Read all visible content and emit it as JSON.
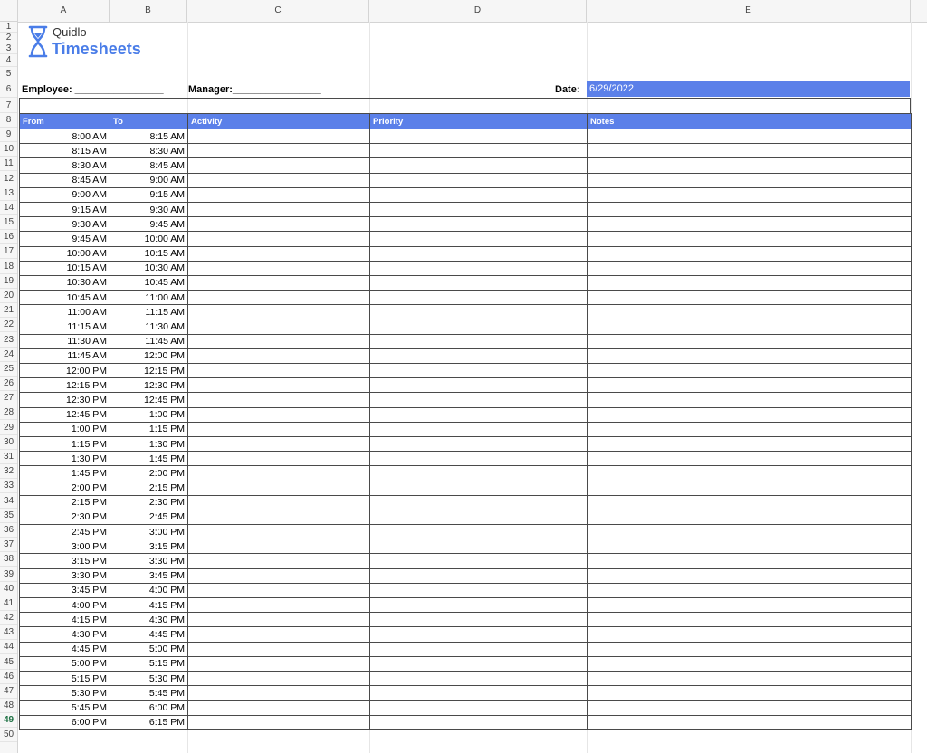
{
  "columns": [
    "A",
    "B",
    "C",
    "D",
    "E"
  ],
  "row_numbers": [
    "1",
    "2",
    "3",
    "4",
    "5",
    "6",
    "7",
    "8",
    "9",
    "10",
    "11",
    "12",
    "13",
    "14",
    "15",
    "16",
    "17",
    "18",
    "19",
    "20",
    "21",
    "22",
    "23",
    "24",
    "25",
    "26",
    "27",
    "28",
    "29",
    "30",
    "31",
    "32",
    "33",
    "34",
    "35",
    "36",
    "37",
    "38",
    "39",
    "40",
    "41",
    "42",
    "43",
    "44",
    "45",
    "46",
    "47",
    "48",
    "49",
    "50"
  ],
  "active_row": "49",
  "brand": {
    "name": "Quidlo",
    "product": "Timesheets"
  },
  "form": {
    "employee_label": "Employee: ________________",
    "manager_label": "Manager:________________",
    "date_label": "Date:",
    "date_value": "6/29/2022"
  },
  "table": {
    "headers": [
      "From",
      "To",
      "Activity",
      "Priority",
      "Notes"
    ],
    "rows": [
      [
        "8:00 AM",
        "8:15 AM"
      ],
      [
        "8:15 AM",
        "8:30 AM"
      ],
      [
        "8:30 AM",
        "8:45 AM"
      ],
      [
        "8:45 AM",
        "9:00 AM"
      ],
      [
        "9:00 AM",
        "9:15 AM"
      ],
      [
        "9:15 AM",
        "9:30 AM"
      ],
      [
        "9:30 AM",
        "9:45 AM"
      ],
      [
        "9:45 AM",
        "10:00 AM"
      ],
      [
        "10:00 AM",
        "10:15 AM"
      ],
      [
        "10:15 AM",
        "10:30 AM"
      ],
      [
        "10:30 AM",
        "10:45 AM"
      ],
      [
        "10:45 AM",
        "11:00 AM"
      ],
      [
        "11:00 AM",
        "11:15 AM"
      ],
      [
        "11:15 AM",
        "11:30 AM"
      ],
      [
        "11:30 AM",
        "11:45 AM"
      ],
      [
        "11:45 AM",
        "12:00 PM"
      ],
      [
        "12:00 PM",
        "12:15 PM"
      ],
      [
        "12:15 PM",
        "12:30 PM"
      ],
      [
        "12:30 PM",
        "12:45 PM"
      ],
      [
        "12:45 PM",
        "1:00 PM"
      ],
      [
        "1:00 PM",
        "1:15 PM"
      ],
      [
        "1:15 PM",
        "1:30 PM"
      ],
      [
        "1:30 PM",
        "1:45 PM"
      ],
      [
        "1:45 PM",
        "2:00 PM"
      ],
      [
        "2:00 PM",
        "2:15 PM"
      ],
      [
        "2:15 PM",
        "2:30 PM"
      ],
      [
        "2:30 PM",
        "2:45 PM"
      ],
      [
        "2:45 PM",
        "3:00 PM"
      ],
      [
        "3:00 PM",
        "3:15 PM"
      ],
      [
        "3:15 PM",
        "3:30 PM"
      ],
      [
        "3:30 PM",
        "3:45 PM"
      ],
      [
        "3:45 PM",
        "4:00 PM"
      ],
      [
        "4:00 PM",
        "4:15 PM"
      ],
      [
        "4:15 PM",
        "4:30 PM"
      ],
      [
        "4:30 PM",
        "4:45 PM"
      ],
      [
        "4:45 PM",
        "5:00 PM"
      ],
      [
        "5:00 PM",
        "5:15 PM"
      ],
      [
        "5:15 PM",
        "5:30 PM"
      ],
      [
        "5:30 PM",
        "5:45 PM"
      ],
      [
        "5:45 PM",
        "6:00 PM"
      ],
      [
        "6:00 PM",
        "6:15 PM"
      ]
    ]
  },
  "colors": {
    "accent": "#5b80e9",
    "brand": "#4a7de8",
    "border": "#4a4a4a"
  },
  "icons": {
    "logo": "hourglass-icon"
  }
}
